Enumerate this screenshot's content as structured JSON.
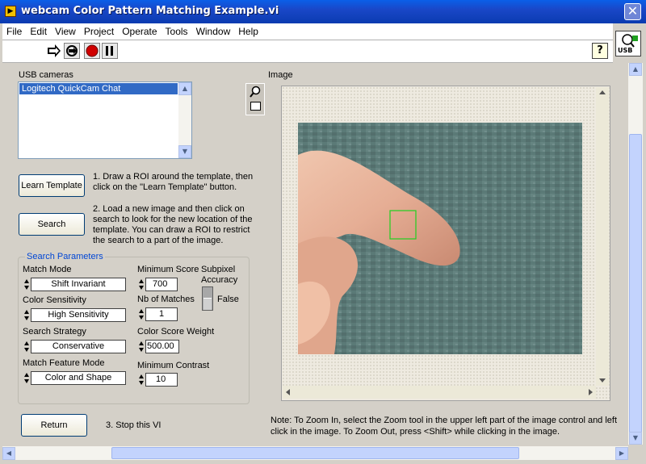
{
  "window": {
    "title": "webcam Color Pattern Matching Example.vi",
    "close_glyph": "✕"
  },
  "menu": [
    "File",
    "Edit",
    "View",
    "Project",
    "Operate",
    "Tools",
    "Window",
    "Help"
  ],
  "toolbar": {
    "icons": [
      "run-arrow-icon",
      "run-continuously-icon",
      "abort-icon",
      "pause-icon"
    ],
    "help_glyph": "?",
    "vi_icon_text": "USB"
  },
  "cameras": {
    "label": "USB cameras",
    "items": [
      "Logitech QuickCam Chat"
    ]
  },
  "buttons": {
    "learn": "Learn Template",
    "search": "Search",
    "return": "Return"
  },
  "instructions": {
    "step1": "1. Draw a ROI around the template,  then click on the \"Learn Template\" button.",
    "step2": "2. Load a new image and then click on search to look for the new location of the template. You can draw a ROI to restrict the search to a part of the image.",
    "step3": "3. Stop this VI"
  },
  "search_params": {
    "title": "Search Parameters",
    "match_mode": {
      "label": "Match Mode",
      "value": "Shift Invariant"
    },
    "color_sensitivity": {
      "label": "Color Sensitivity",
      "value": "High Sensitivity"
    },
    "search_strategy": {
      "label": "Search Strategy",
      "value": "Conservative"
    },
    "match_feature_mode": {
      "label": "Match Feature Mode",
      "value": "Color and Shape"
    },
    "minimum_score": {
      "label": "Minimum Score",
      "value": "700"
    },
    "nb_matches": {
      "label": "Nb of Matches",
      "value": "1"
    },
    "color_score_weight": {
      "label": "Color Score Weight",
      "value": "500.00"
    },
    "minimum_contrast": {
      "label": "Minimum Contrast",
      "value": "10"
    },
    "subpixel": {
      "label": "Subpixel Accuracy",
      "value": "False"
    }
  },
  "image": {
    "label": "Image",
    "note": "Note: To Zoom In, select the Zoom tool in the upper left part of the image control and left click in the image.  To Zoom Out, press <Shift> while clicking in the image."
  }
}
